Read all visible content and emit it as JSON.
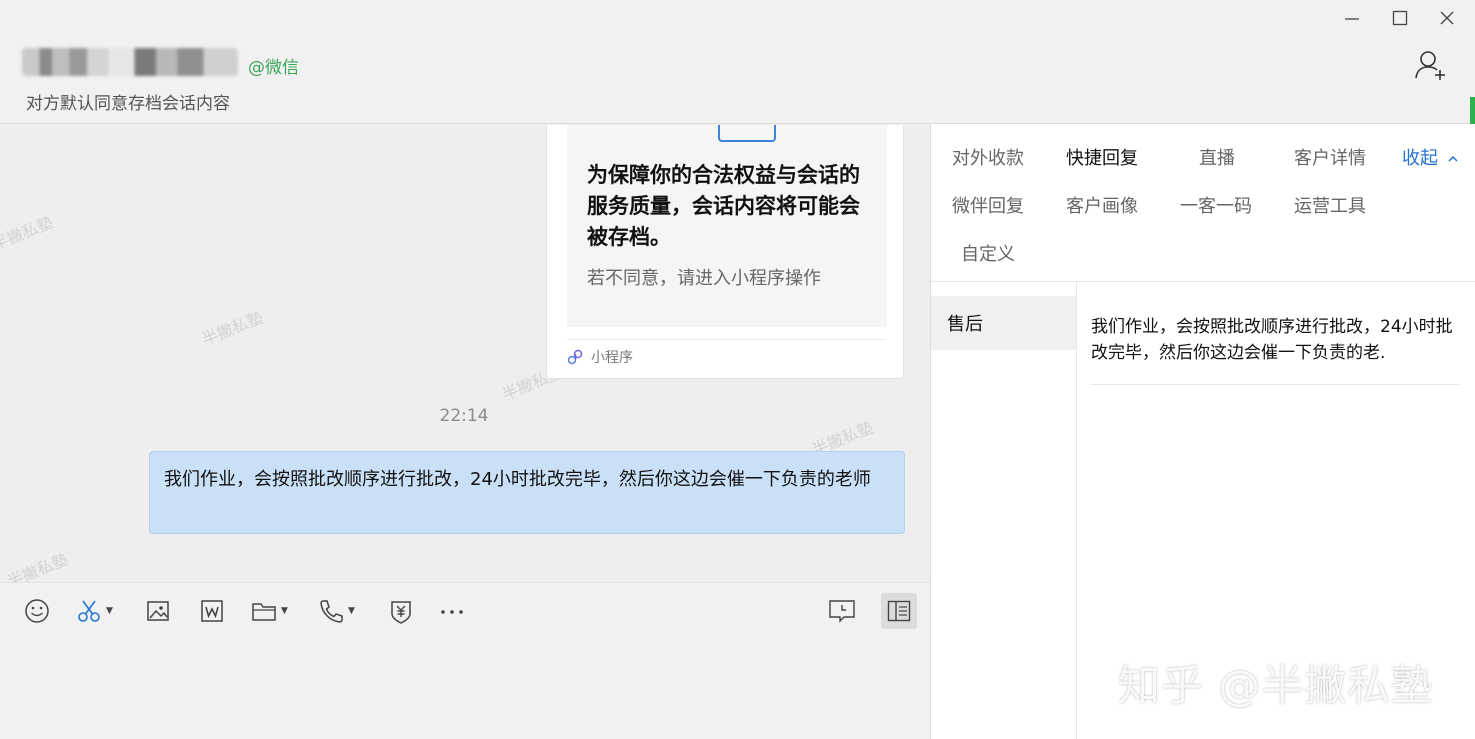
{
  "header": {
    "contact_suffix": "@微信",
    "subtitle": "对方默认同意存档会话内容"
  },
  "chat": {
    "card": {
      "title": "为保障你的合法权益与会话的服务质量，会话内容将可能会被存档。",
      "subtitle": "若不同意，请进入小程序操作",
      "footer": "小程序"
    },
    "timestamp": "22:14",
    "message": "我们作业，会按照批改顺序进行批改，24小时批改完毕，然后你这边会催一下负责的老师",
    "watermark": "半撇私塾"
  },
  "toolbar": {
    "icons": [
      "emoji-icon",
      "screenshot-icon",
      "image-icon",
      "document-icon",
      "folder-icon",
      "phone-icon",
      "payment-icon",
      "more-icon",
      "history-icon",
      "sidebar-toggle-icon"
    ]
  },
  "panel": {
    "tabs": {
      "t1": "对外收款",
      "t2": "快捷回复",
      "t3": "直播",
      "t4": "客户详情",
      "collapse": "收起",
      "t5": "微伴回复",
      "t6": "客户画像",
      "t7": "一客一码",
      "t8": "运营工具",
      "t9": "自定义"
    },
    "category": "售后",
    "reply_text": "我们作业，会按照批改顺序进行批改，24小时批改完毕，然后你这边会催一下负责的老."
  },
  "watermark_footer": "知乎 @半撇私塾",
  "colors": {
    "bubble": "#c9e0f7",
    "link": "#2474d0",
    "wechat_green": "#3aa655"
  }
}
